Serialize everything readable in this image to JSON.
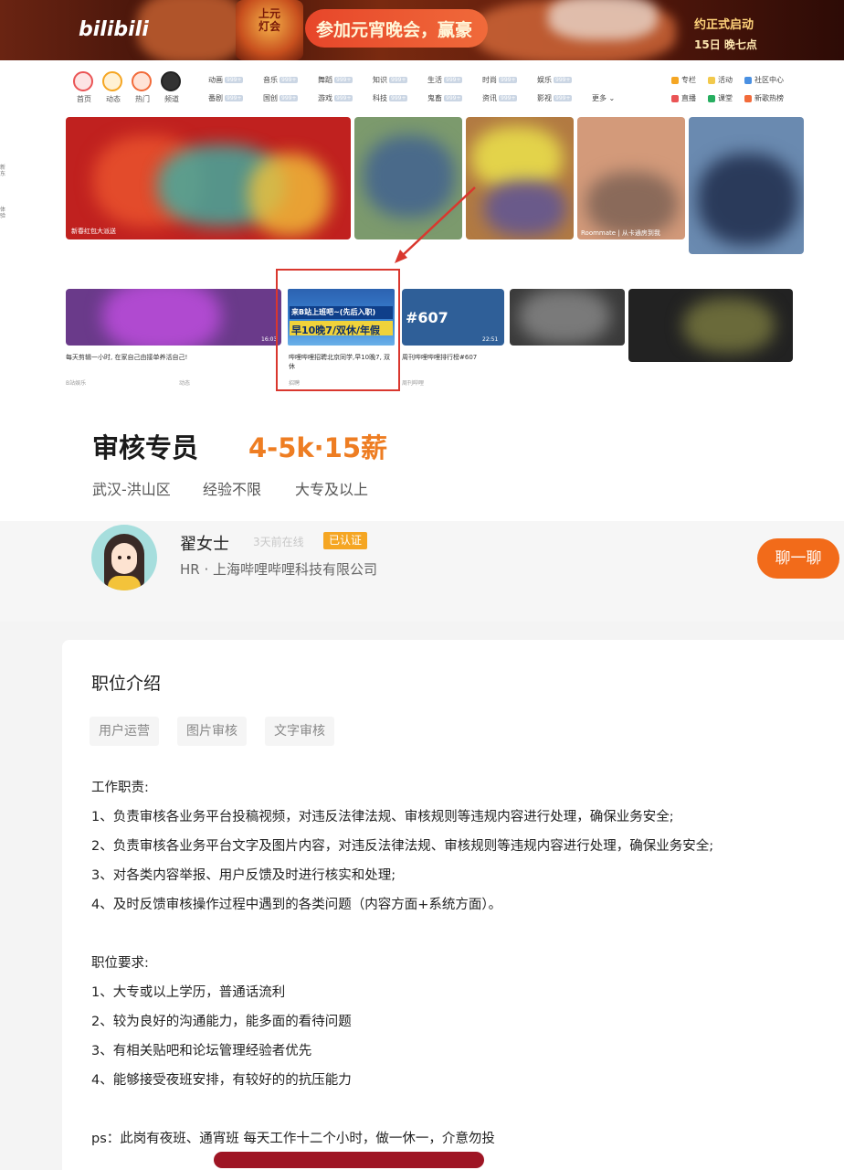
{
  "bilibili": {
    "logo": "bilibili",
    "banner_lantern": "上元灯会",
    "banner_pill": "参加元宵晚会，赢豪",
    "banner_right_tag": "约正式启动",
    "banner_right_date": "15日 晚七点",
    "nav_icons": [
      {
        "label": "首页",
        "color": "#ea5455"
      },
      {
        "label": "动态",
        "color": "#f5a623"
      },
      {
        "label": "热门",
        "color": "#f26b3a"
      },
      {
        "label": "频道",
        "color": "#222222"
      }
    ],
    "categories_row1": [
      "动画",
      "音乐",
      "舞蹈",
      "知识",
      "生活",
      "时尚",
      "娱乐"
    ],
    "categories_row2": [
      "番剧",
      "国创",
      "游戏",
      "科技",
      "鬼畜",
      "资讯",
      "影视",
      "更多"
    ],
    "right_nav_row1": [
      "专栏",
      "活动",
      "社区中心"
    ],
    "right_nav_row2": [
      "直播",
      "课堂",
      "新歌热榜"
    ],
    "carousel_caption": "新春红包大派送",
    "tile_captions": [
      "Roommate | 从卡通房到我"
    ],
    "job_banner_line1": "来B站上班吧~(先后入职)",
    "job_banner_line2": "早10晚7/双休/年假",
    "job_card_caption": "哔哩哔哩招聘北京同学,早10晚7, 双休",
    "job_card_meta": "招聘",
    "card_captions": [
      "每天剪辑一小时, 在家自己由接单养活自己!",
      "周刊哔哩哔哩排行榜#607"
    ],
    "card_metas": [
      "B站娱乐",
      "动态",
      "周刊哔哩"
    ],
    "card_duration": "16:03",
    "card_duration2": "22:51",
    "card_607": "#607",
    "side_tabs": [
      "新东",
      "体验"
    ]
  },
  "job": {
    "title": "审核专员",
    "salary": "4-5k·15薪",
    "tags": [
      "武汉-洪山区",
      "经验不限",
      "大专及以上"
    ]
  },
  "hr": {
    "name": "翟女士",
    "online": "3天前在线",
    "badge": "已认证",
    "company": "HR · 上海哔哩哔哩科技有限公司",
    "chat_button": "聊一聊"
  },
  "description": {
    "section_title": "职位介绍",
    "chips": [
      "用户运营",
      "图片审核",
      "文字审核"
    ],
    "duties_title": "工作职责:",
    "duties": [
      "1、负责审核各业务平台投稿视频，对违反法律法规、审核规则等违规内容进行处理，确保业务安全;",
      "2、负责审核各业务平台文字及图片内容，对违反法律法规、审核规则等违规内容进行处理，确保业务安全;",
      "3、对各类内容举报、用户反馈及时进行核实和处理;",
      "4、及时反馈审核操作过程中遇到的各类问题（内容方面+系统方面）。"
    ],
    "requirements_title": "职位要求:",
    "requirements": [
      "1、大专或以上学历，普通话流利",
      "2、较为良好的沟通能力，能多面的看待问题",
      "3、有相关贴吧和论坛管理经验者优先",
      "4、能够接受夜班安排，有较好的的抗压能力"
    ],
    "ps": "ps：此岗有夜班、通宵班  每天工作十二个小时，做一休一，介意勿投"
  }
}
